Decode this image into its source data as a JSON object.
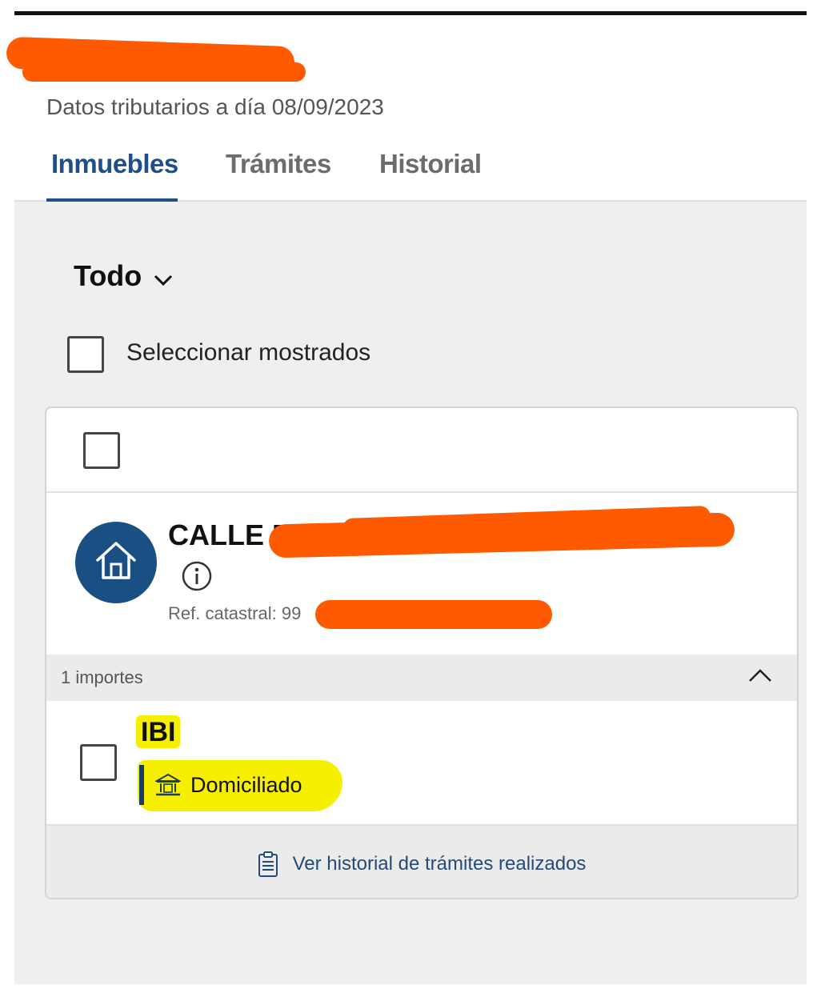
{
  "header": {
    "subtitle": "Datos tributarios a día 08/09/2023"
  },
  "tabs": [
    {
      "label": "Inmuebles",
      "active": true
    },
    {
      "label": "Trámites",
      "active": false
    },
    {
      "label": "Historial",
      "active": false
    }
  ],
  "filter": {
    "label": "Todo",
    "icon": "chevron-down-icon"
  },
  "selection": {
    "label": "Seleccionar mostrados",
    "checked": false
  },
  "property": {
    "address_visible": "CALLE D",
    "ref_label": "Ref. catastral: 99",
    "icon": "house-icon",
    "info_icon": "info-icon",
    "importes": {
      "label": "1 importes",
      "expanded": true
    },
    "items": [
      {
        "name": "IBI",
        "status": "Domiciliado",
        "status_icon": "bank-icon",
        "checked": false
      }
    ],
    "footer_link": "Ver historial de trámites realizados",
    "footer_icon": "clipboard-icon"
  },
  "colors": {
    "accent": "#1f4f8a",
    "avatar_bg": "#1a4f84",
    "redaction": "#ff5a00",
    "highlight": "#f6ef00",
    "panel_bg": "#efefef"
  }
}
